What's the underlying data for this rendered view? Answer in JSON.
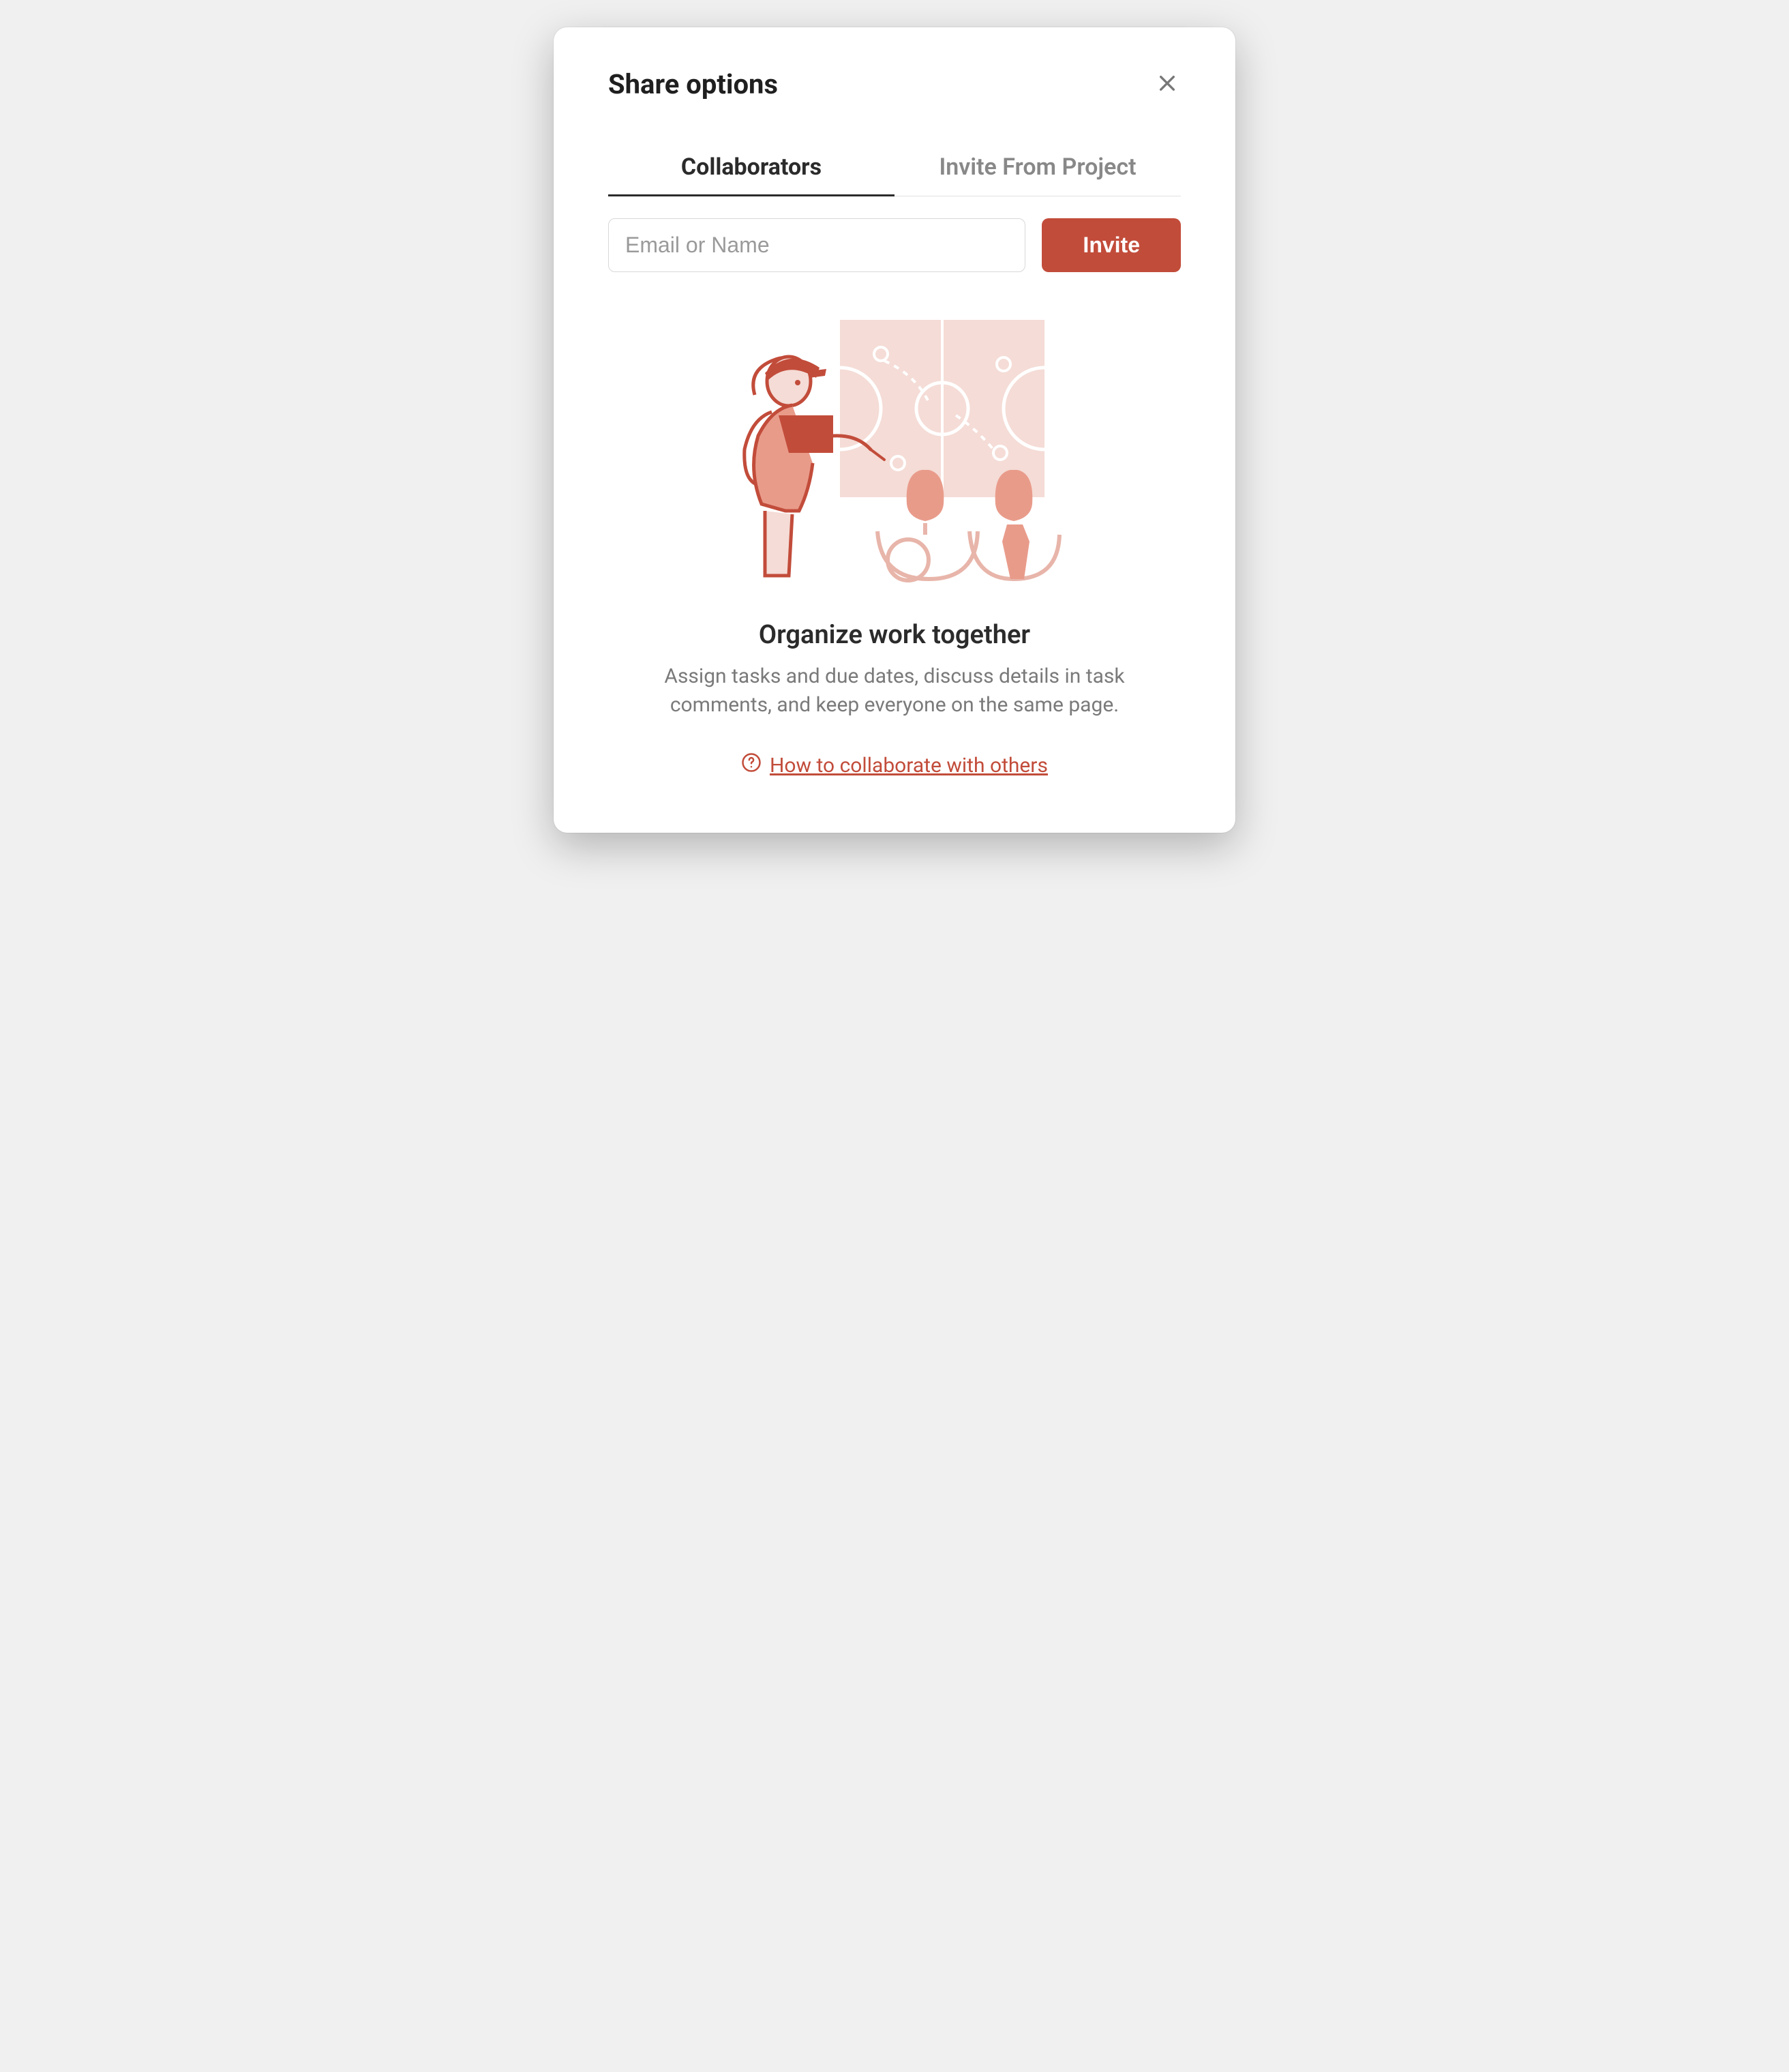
{
  "modal": {
    "title": "Share options"
  },
  "tabs": [
    {
      "label": "Collaborators",
      "active": true
    },
    {
      "label": "Invite From Project",
      "active": false
    }
  ],
  "invite": {
    "placeholder": "Email or Name",
    "button_label": "Invite"
  },
  "content": {
    "title": "Organize work together",
    "description": "Assign tasks and due dates, discuss details in task comments, and keep everyone on the same page.",
    "help_link_label": "How to collaborate with others"
  },
  "icons": {
    "close": "close-icon",
    "help": "help-icon"
  },
  "colors": {
    "accent": "#c24c3a",
    "text_primary": "#2b2b2b",
    "text_secondary": "#7a7a7a"
  }
}
